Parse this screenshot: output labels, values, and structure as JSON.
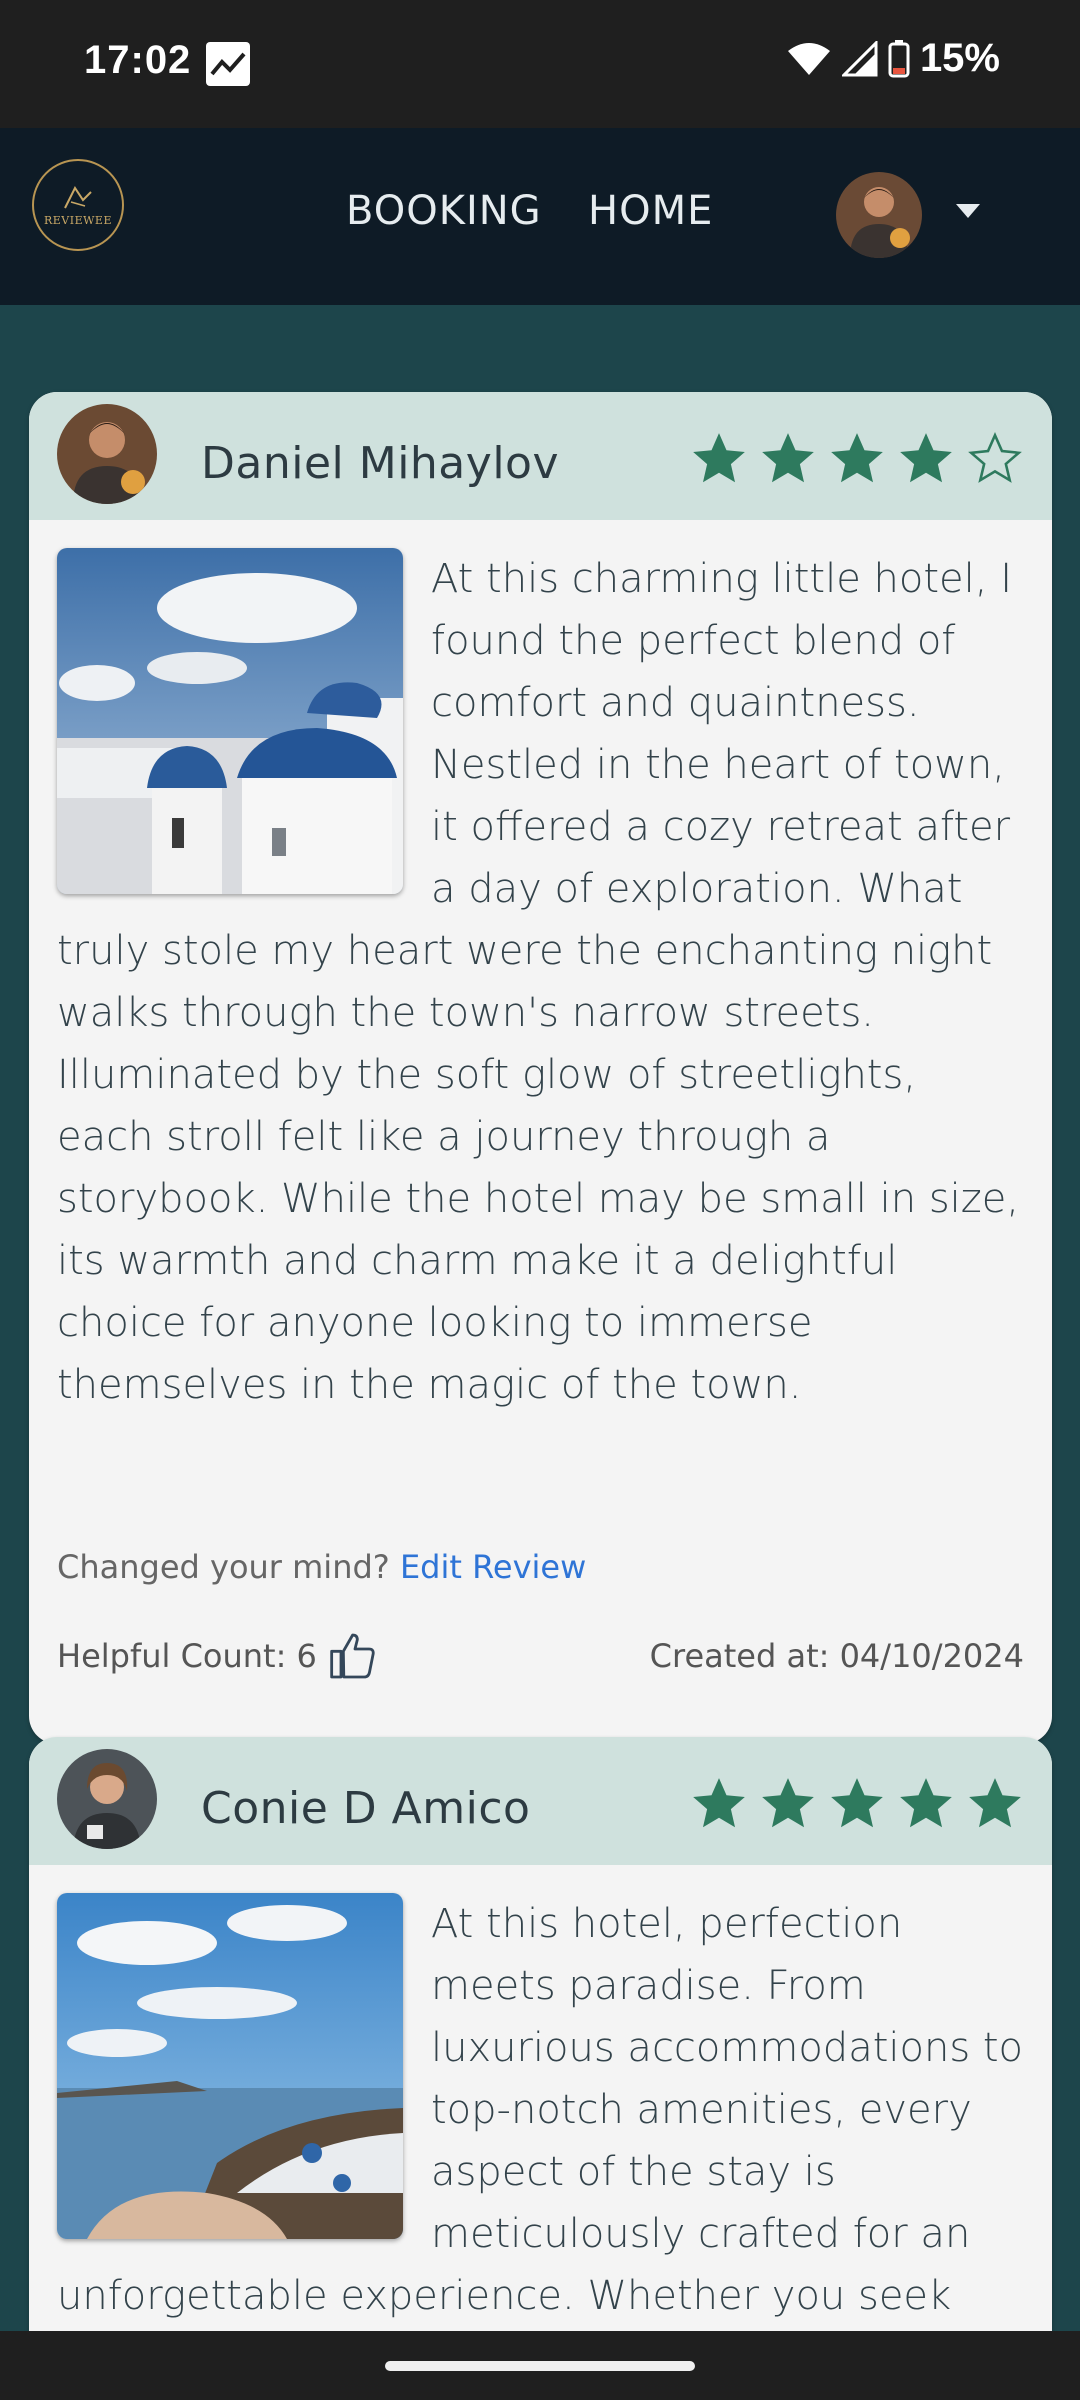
{
  "status_bar": {
    "time": "17:02",
    "battery_percent": "15%",
    "icons": [
      "gallery-icon",
      "wifi-icon",
      "signal-icon",
      "battery-icon"
    ]
  },
  "navbar": {
    "logo_text": "REVIEWEE",
    "links": [
      "BOOKING",
      "HOME"
    ]
  },
  "colors": {
    "page_bg": "#1d454b",
    "navbar_bg": "#0e1b26",
    "card_header_bg": "#cfe1dd",
    "star_color": "#2e7a5e",
    "link_color": "#2e74d6"
  },
  "reviews": [
    {
      "author": "Daniel Mihaylov",
      "rating": 4,
      "max_rating": 5,
      "text": "At this charming little hotel, I found the perfect blend of comfort and quaintness. Nestled in the heart of town, it offered a cozy retreat after a day of exploration. What truly stole my heart were the enchanting night walks through the town's narrow streets. Illuminated by the soft glow of streetlights, each stroll felt like a journey through a storybook. While the hotel may be small in size, its warmth and charm make it a delightful choice for anyone looking to immerse themselves in the magic of the town.",
      "edit_prompt": "Changed your mind?",
      "edit_link": "Edit Review",
      "helpful_label": "Helpful Count: 6",
      "created_label": "Created at: 04/10/2024"
    },
    {
      "author": "Conie D Amico",
      "rating": 5,
      "max_rating": 5,
      "text": "At this hotel, perfection meets paradise. From luxurious accommodations to top-notch amenities, every aspect of the stay is meticulously crafted for an unforgettable experience. Whether you seek relaxation by the pool, adventure"
    }
  ]
}
